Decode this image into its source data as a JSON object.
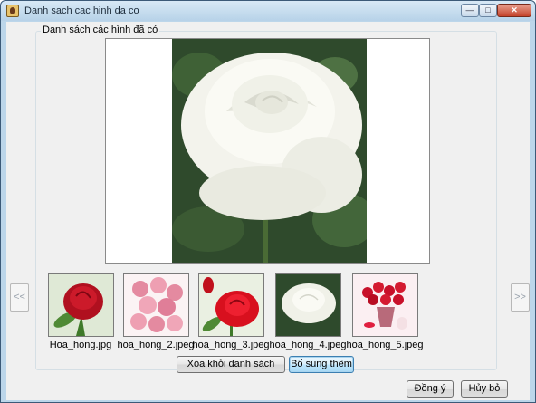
{
  "window": {
    "title": "Danh sach cac hinh da co",
    "controls": {
      "minimize": "—",
      "maximize": "□",
      "close": "✕"
    }
  },
  "group": {
    "title": "Danh sách các hình đã có"
  },
  "preview": {
    "image": "white-rose",
    "selected_index": 3
  },
  "nav": {
    "prev": "<<",
    "next": ">>"
  },
  "thumbnails": [
    {
      "file": "Hoa_hong.jpg",
      "image": "red-rose"
    },
    {
      "file": "hoa_hong_2.jpeg",
      "image": "pink-roses"
    },
    {
      "file": "hoa_hong_3.jpeg",
      "image": "red-roses"
    },
    {
      "file": "hoa_hong_4.jpeg",
      "image": "white-rose"
    },
    {
      "file": "hoa_hong_5.jpeg",
      "image": "rose-bouquet"
    }
  ],
  "buttons": {
    "remove": "Xóa khỏi danh sách",
    "add": "Bổ sung thêm",
    "ok": "Đồng ý",
    "cancel": "Hủy bỏ"
  },
  "colors": {
    "accent": "#3c7fb1",
    "titlebar": "#bcd6ea"
  }
}
